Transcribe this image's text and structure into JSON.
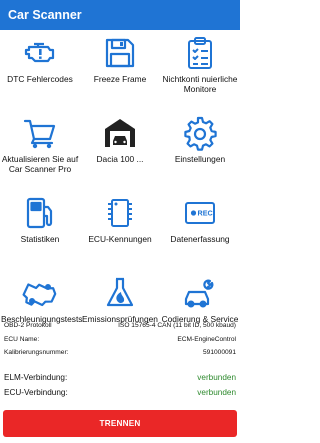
{
  "app": {
    "title": "Car Scanner"
  },
  "tiles": [
    {
      "label": "DTC Fehlercodes",
      "icon": "engine-warning-icon"
    },
    {
      "label": "Freeze Frame",
      "icon": "floppy-disk-icon"
    },
    {
      "label": "Nichtkonti nuierliche Monitore",
      "icon": "clipboard-checklist-icon"
    },
    {
      "label": "Aktualisieren Sie auf Car Scanner Pro",
      "icon": "shopping-cart-icon"
    },
    {
      "label": "Dacia 100 ...",
      "icon": "garage-car-icon"
    },
    {
      "label": "Einstellungen",
      "icon": "gear-icon"
    },
    {
      "label": "Statistiken",
      "icon": "fuel-pump-icon"
    },
    {
      "label": "ECU-Kennungen",
      "icon": "chip-icon"
    },
    {
      "label": "Datenerfassung",
      "icon": "record-icon"
    },
    {
      "label": "Beschleunigungstests",
      "icon": "race-car-icon"
    },
    {
      "label": "Emissionsprüfungen",
      "icon": "flask-leaf-icon"
    },
    {
      "label": "Codierung & Service",
      "icon": "car-wrench-icon"
    }
  ],
  "info": [
    {
      "key": "OBD-2 Protokoll",
      "value": "ISO 15765-4 CAN (11 bit ID, 500 kbaud)"
    },
    {
      "key": "ECU Name:",
      "value": "ECM-EngineControl"
    },
    {
      "key": "Kalibrierungsnummer:",
      "value": "591000091"
    }
  ],
  "connections": [
    {
      "key": "ELM-Verbindung:",
      "value": "verbunden"
    },
    {
      "key": "ECU-Verbindung:",
      "value": "verbunden"
    }
  ],
  "disconnect_button": {
    "label": "TRENNEN"
  },
  "colors": {
    "primary": "#1f74d4",
    "danger": "#ea2727",
    "success": "#2e8a2e"
  }
}
